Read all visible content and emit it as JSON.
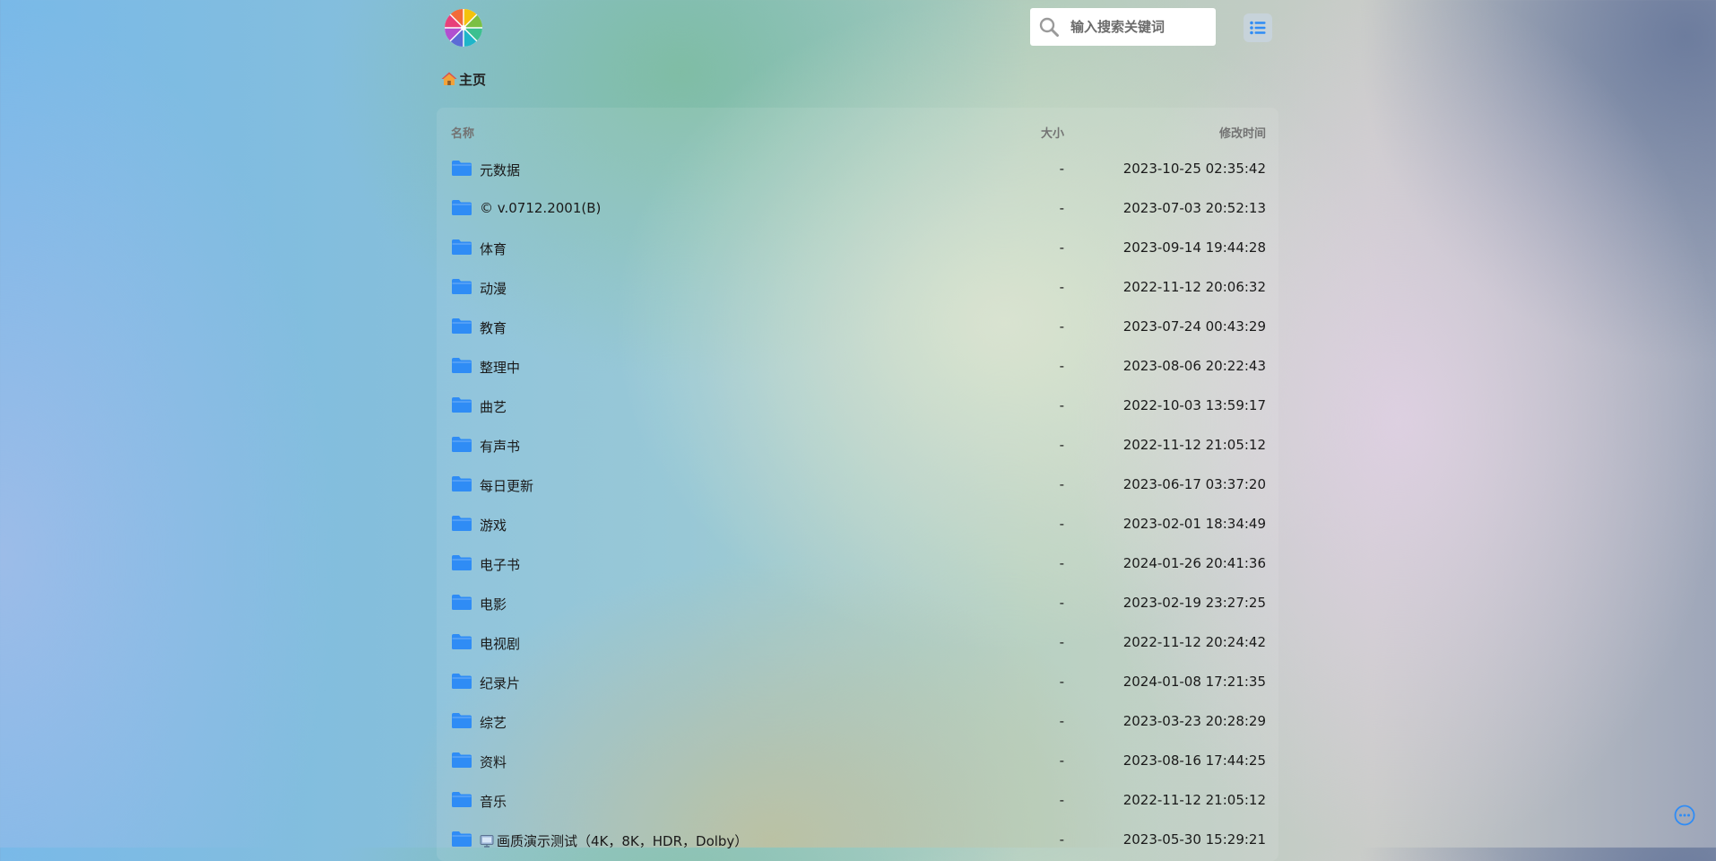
{
  "header": {
    "logo_icon": "color-wheel-logo-icon",
    "search_icon": "search-icon",
    "search_placeholder": "输入搜索关键词",
    "list_view_icon": "list-view-icon"
  },
  "breadcrumb": {
    "home_icon": "house-emoji-icon",
    "home_label": "主页"
  },
  "table": {
    "columns": {
      "name": "名称",
      "size": "大小",
      "modified": "修改时间"
    },
    "rows": [
      {
        "name": "元数据",
        "size": "-",
        "modified": "2023-10-25 02:35:42"
      },
      {
        "name": "© v.0712.2001(B)",
        "size": "-",
        "modified": "2023-07-03 20:52:13"
      },
      {
        "name": "体育",
        "size": "-",
        "modified": "2023-09-14 19:44:28"
      },
      {
        "name": "动漫",
        "size": "-",
        "modified": "2022-11-12 20:06:32"
      },
      {
        "name": "教育",
        "size": "-",
        "modified": "2023-07-24 00:43:29"
      },
      {
        "name": "整理中",
        "size": "-",
        "modified": "2023-08-06 20:22:43"
      },
      {
        "name": "曲艺",
        "size": "-",
        "modified": "2022-10-03 13:59:17"
      },
      {
        "name": "有声书",
        "size": "-",
        "modified": "2022-11-12 21:05:12"
      },
      {
        "name": "每日更新",
        "size": "-",
        "modified": "2023-06-17 03:37:20"
      },
      {
        "name": "游戏",
        "size": "-",
        "modified": "2023-02-01 18:34:49"
      },
      {
        "name": "电子书",
        "size": "-",
        "modified": "2024-01-26 20:41:36"
      },
      {
        "name": "电影",
        "size": "-",
        "modified": "2023-02-19 23:27:25"
      },
      {
        "name": "电视剧",
        "size": "-",
        "modified": "2022-11-12 20:24:42"
      },
      {
        "name": "纪录片",
        "size": "-",
        "modified": "2024-01-08 17:21:35"
      },
      {
        "name": "综艺",
        "size": "-",
        "modified": "2023-03-23 20:28:29"
      },
      {
        "name": "资料",
        "size": "-",
        "modified": "2023-08-16 17:44:25"
      },
      {
        "name": "音乐",
        "size": "-",
        "modified": "2022-11-12 21:05:12"
      },
      {
        "name": "画质演示测试（4K，8K，HDR，Dolby）",
        "size": "-",
        "modified": "2023-05-30 15:29:21",
        "prefix_icon": "tv-emoji-icon"
      }
    ]
  },
  "colors": {
    "folder": "#2f8cf5",
    "accent": "#1e88e5",
    "search_bg": "#ffffff"
  },
  "floating": {
    "more_icon": "more-options-icon"
  }
}
